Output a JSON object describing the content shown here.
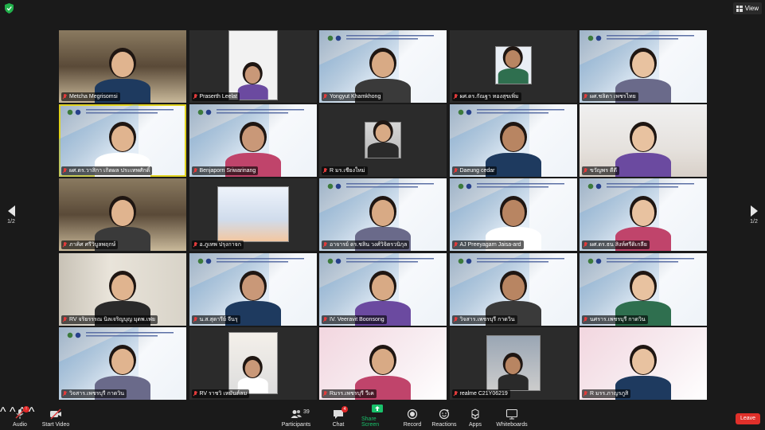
{
  "top": {
    "view_label": "View"
  },
  "pager": {
    "left_text": "1/2",
    "right_text": "1/2"
  },
  "tiles": [
    {
      "name": "Metcha Megrisomsi",
      "muted": true,
      "bg": "room"
    },
    {
      "name": "Praserth Leelat",
      "muted": true,
      "bg": "dark"
    },
    {
      "name": "Yongyut Khamkhong",
      "muted": true,
      "bg": "slide"
    },
    {
      "name": "ผศ.ดร.กัณฐา ทองสุขเพิ่ม",
      "muted": true,
      "bg": "dark"
    },
    {
      "name": "ผศ.ชลิตา เพชรไทย",
      "muted": true,
      "bg": "slide"
    },
    {
      "name": "ผศ.ดร.วาสิกา เกิดผล ประเทพศักดิ์",
      "muted": true,
      "bg": "slide",
      "active": true
    },
    {
      "name": "Benjaporn Sriwarinang",
      "muted": true,
      "bg": "slide"
    },
    {
      "name": "R มร.เชียงใหม่",
      "muted": true,
      "bg": "dark"
    },
    {
      "name": "Daeung cedar",
      "muted": true,
      "bg": "slide"
    },
    {
      "name": "ขวัญพร ดีดี",
      "muted": true,
      "bg": "office"
    },
    {
      "name": "ภาคิศ ศรีวิบูลพฤกษ์",
      "muted": true,
      "bg": "room"
    },
    {
      "name": "อ.ภูเทพ ปรุงกาจก",
      "muted": true,
      "bg": "dark"
    },
    {
      "name": "อาจารย์ ดร.ชลิน วงศ์วิจิตรวนิกุล",
      "muted": true,
      "bg": "slide"
    },
    {
      "name": "AJ Preeyagarn Jaisa-ard",
      "muted": true,
      "bg": "slide"
    },
    {
      "name": "ผศ.ดร.ธน สิงห์ศรีดิเกลีย",
      "muted": true,
      "bg": "slide"
    },
    {
      "name": "RV จริยรรรณ นิลเจริญบุญ มุดพ.เฟย",
      "muted": true,
      "bg": "shelf"
    },
    {
      "name": "น.ส.สุดารีย์ จีนรุ",
      "muted": true,
      "bg": "slide"
    },
    {
      "name": "IV. Veeravit Boonsong",
      "muted": true,
      "bg": "slide"
    },
    {
      "name": "วิจสาร.เพชรบุรี กาดวิน",
      "muted": true,
      "bg": "slide"
    },
    {
      "name": "นศราร.เพชรบุรี กาดวิน",
      "muted": true,
      "bg": "slide"
    },
    {
      "name": "วิจสาร.เพชรบุรี กาดวิน",
      "muted": true,
      "bg": "slide"
    },
    {
      "name": "RV ราชวิ เหมันต์ลม",
      "muted": true,
      "bg": "dark"
    },
    {
      "name": "Rมรร.เพชรบุรี วีเค",
      "muted": true,
      "bg": "pink"
    },
    {
      "name": "realme C21Y06219",
      "muted": true,
      "bg": "dark"
    },
    {
      "name": "R มรร.ภาญรภูสิ",
      "muted": true,
      "bg": "pink"
    }
  ],
  "toolbar": {
    "audio": "Audio",
    "start_video": "Start Video",
    "participants": "Participants",
    "participants_count": "39",
    "chat": "Chat",
    "chat_badge": "4",
    "share_screen": "Share Screen",
    "record": "Record",
    "reactions": "Reactions",
    "apps": "Apps",
    "whiteboards": "Whiteboards",
    "leave": "Leave"
  },
  "colors": {
    "leave": "#e0302a",
    "share": "#19c26b",
    "active_border": "#e0d21f",
    "muted_mic": "#e23b3b"
  }
}
